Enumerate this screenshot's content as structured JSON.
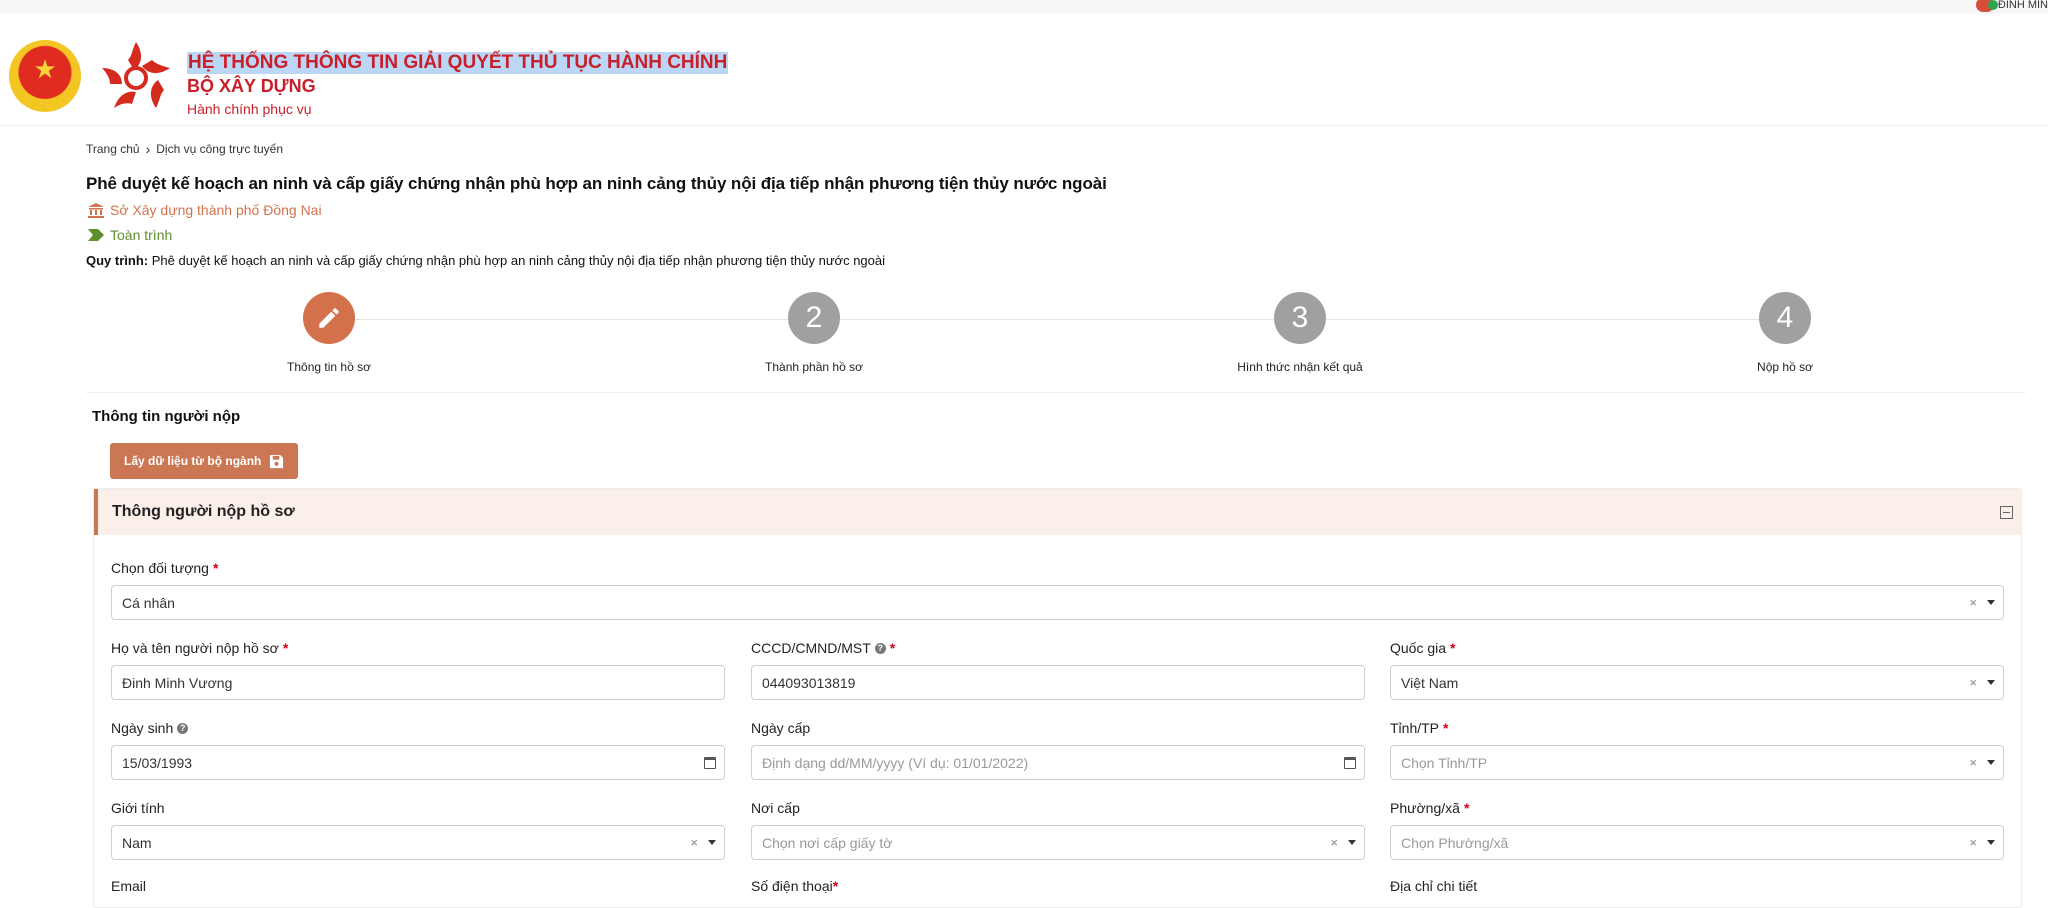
{
  "user": {
    "name": "ĐINH MIN"
  },
  "header": {
    "system_title": "HỆ THỐNG THÔNG TIN GIẢI QUYẾT THỦ TỤC HÀNH CHÍNH",
    "ministry": "BỘ XÂY DỰNG",
    "slogan": "Hành chính phục vụ"
  },
  "breadcrumb": {
    "home": "Trang chủ",
    "current": "Dịch vụ công trực tuyến"
  },
  "procedure": {
    "title": "Phê duyệt kế hoạch an ninh và cấp giấy chứng nhận phù hợp an ninh cảng thủy nội địa tiếp nhận phương tiện thủy nước ngoài",
    "agency": "Sở Xây dựng thành phố Đồng Nai",
    "scope": "Toàn trình",
    "process_label": "Quy trình:",
    "process_value": "Phê duyệt kế hoạch an ninh và cấp giấy chứng nhận phù hợp an ninh cảng thủy nội địa tiếp nhận phương tiện thủy nước ngoài"
  },
  "steps": [
    {
      "number": "",
      "label": "Thông tin hồ sơ",
      "active": true
    },
    {
      "number": "2",
      "label": "Thành phần hồ sơ",
      "active": false
    },
    {
      "number": "3",
      "label": "Hình thức nhận kết quả",
      "active": false
    },
    {
      "number": "4",
      "label": "Nộp hồ sơ",
      "active": false
    }
  ],
  "section": {
    "title": "Thông tin người nộp",
    "fetch_button": "Lấy dữ liệu từ bộ ngành",
    "panel_title": "Thông người nộp hồ sơ"
  },
  "form": {
    "object_type": {
      "label": "Chọn đối tượng",
      "value": "Cá nhân"
    },
    "full_name": {
      "label": "Họ và tên người nộp hồ sơ",
      "value": "Đinh Minh Vương"
    },
    "id_number": {
      "label": "CCCD/CMND/MST",
      "value": "044093013819"
    },
    "country": {
      "label": "Quốc gia",
      "value": "Việt Nam"
    },
    "birth_date": {
      "label": "Ngày sinh",
      "value": "15/03/1993"
    },
    "issue_date": {
      "label": "Ngày cấp",
      "placeholder": "Định dạng dd/MM/yyyy (Ví dụ: 01/01/2022)"
    },
    "province": {
      "label": "Tỉnh/TP",
      "placeholder": "Chọn Tỉnh/TP"
    },
    "gender": {
      "label": "Giới tính",
      "value": "Nam"
    },
    "issue_place": {
      "label": "Nơi cấp",
      "placeholder": "Chọn nơi cấp giấy tờ"
    },
    "ward": {
      "label": "Phường/xã",
      "placeholder": "Chọn Phường/xã"
    },
    "email": {
      "label": "Email"
    },
    "phone": {
      "label": "Số điện thoại"
    },
    "address": {
      "label": "Địa chỉ chi tiết"
    }
  },
  "colors": {
    "brand_red": "#c8202b",
    "accent": "#cc7754",
    "scope_green": "#5f8f2e"
  }
}
